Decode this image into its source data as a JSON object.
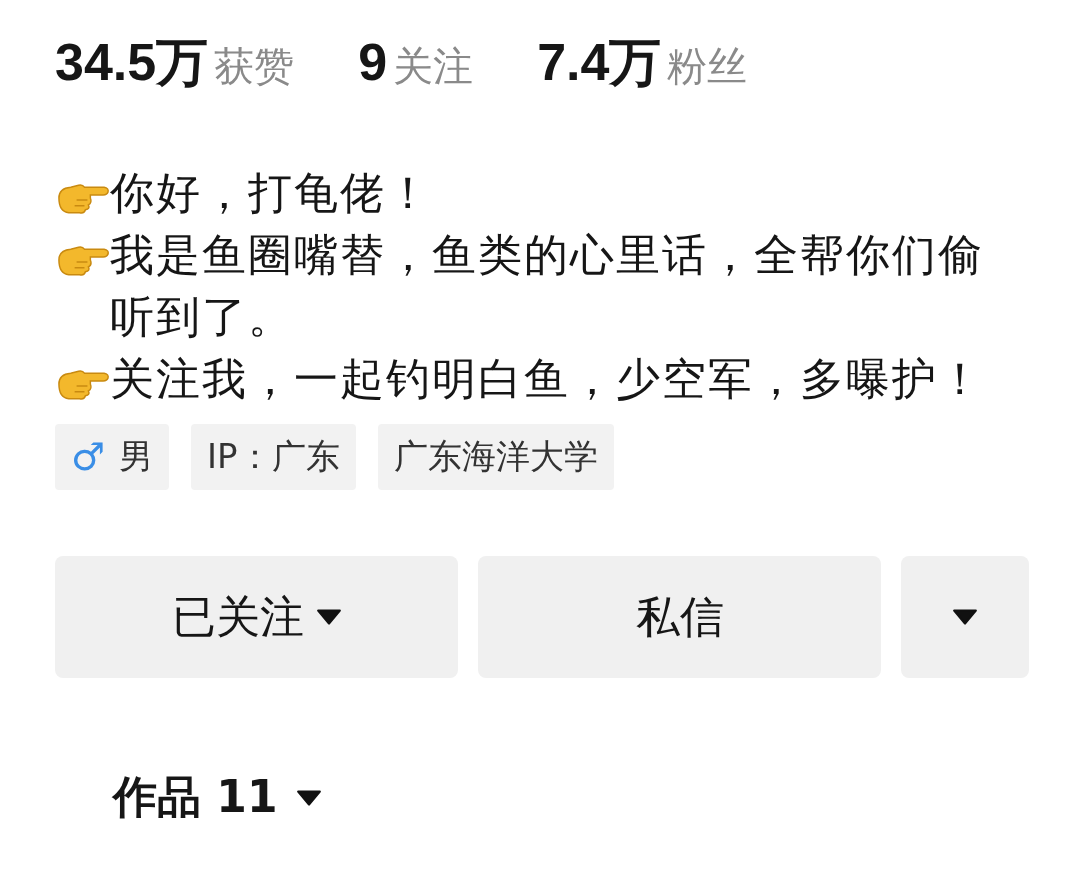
{
  "stats": [
    {
      "count": "34.5万",
      "caption": "获赞"
    },
    {
      "count": "9",
      "caption": "关注"
    },
    {
      "count": "7.4万",
      "caption": "粉丝"
    }
  ],
  "bio": [
    "你好，打龟佬！",
    "我是鱼圈嘴替，鱼类的心里话，全帮你们偷听到了。",
    "关注我，一起钓明白鱼，少空军，多曝护！"
  ],
  "tags": [
    {
      "kind": "gender",
      "symbol": "♂",
      "text": "男"
    },
    {
      "kind": "text",
      "text": "IP：广东"
    },
    {
      "kind": "text",
      "text": "广东海洋大学"
    }
  ],
  "buttons": [
    {
      "label": "已关注",
      "caret": true
    },
    {
      "label": "私信",
      "caret": false
    },
    {
      "caret": true
    }
  ],
  "tab": {
    "label": "作品 11",
    "caret": true
  }
}
